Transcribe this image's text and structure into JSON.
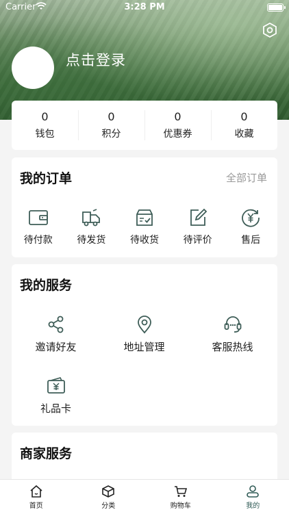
{
  "status_bar": {
    "carrier": "Carrier",
    "time": "3:28 PM"
  },
  "header": {
    "login_text": "点击登录"
  },
  "stats": [
    {
      "value": "0",
      "label": "钱包"
    },
    {
      "value": "0",
      "label": "积分"
    },
    {
      "value": "0",
      "label": "优惠券"
    },
    {
      "value": "0",
      "label": "收藏"
    }
  ],
  "orders": {
    "title": "我的订单",
    "all_link": "全部订单",
    "items": [
      {
        "label": "待付款",
        "icon": "wallet-icon"
      },
      {
        "label": "待发货",
        "icon": "truck-icon"
      },
      {
        "label": "待收货",
        "icon": "box-icon"
      },
      {
        "label": "待评价",
        "icon": "edit-icon"
      },
      {
        "label": "售后",
        "icon": "yen-refund-icon"
      }
    ]
  },
  "services": {
    "title": "我的服务",
    "items": [
      {
        "label": "邀请好友",
        "icon": "share-icon"
      },
      {
        "label": "地址管理",
        "icon": "location-icon"
      },
      {
        "label": "客服热线",
        "icon": "headset-icon"
      },
      {
        "label": "礼品卡",
        "icon": "gift-card-icon"
      }
    ]
  },
  "merchant": {
    "title": "商家服务"
  },
  "tabbar": {
    "active_index": 3,
    "items": [
      {
        "label": "首页",
        "icon": "home-icon"
      },
      {
        "label": "分类",
        "icon": "category-icon"
      },
      {
        "label": "购物车",
        "icon": "cart-icon"
      },
      {
        "label": "我的",
        "icon": "profile-icon"
      }
    ]
  },
  "colors": {
    "icon": "#3e5d57",
    "active_tab": "#2f5a55",
    "muted": "#999999"
  }
}
